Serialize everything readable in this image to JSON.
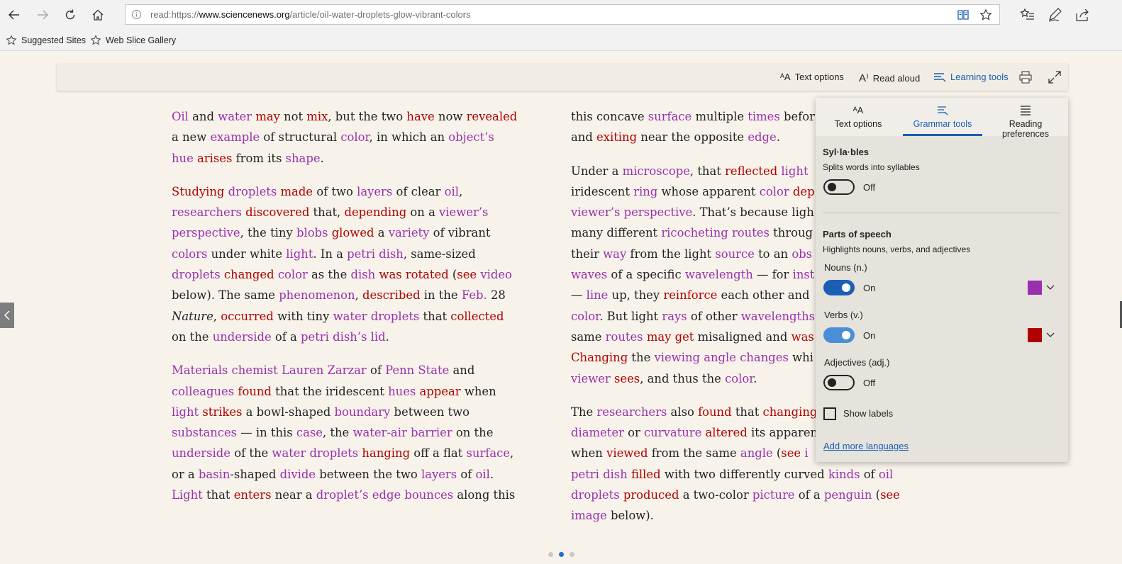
{
  "browser": {
    "url_prefix": "read:https://",
    "url_host": "www.sciencenews.org",
    "url_path": "/article/oil-water-droplets-glow-vibrant-colors",
    "favorites": [
      {
        "label": "Suggested Sites",
        "icon": "star-outline-icon"
      },
      {
        "label": "Web Slice Gallery",
        "icon": "star-outline-icon"
      }
    ]
  },
  "reading_toolbar": {
    "text_options": "Text options",
    "read_aloud": "Read aloud",
    "learning_tools": "Learning tools"
  },
  "article": {
    "col1": [
      [
        [
          "n",
          "Oil"
        ],
        [
          "t",
          " and "
        ],
        [
          "n",
          "water"
        ],
        [
          "t",
          " "
        ],
        [
          "v",
          "may"
        ],
        [
          "t",
          " not "
        ],
        [
          "v",
          "mix"
        ],
        [
          "t",
          ", but the two "
        ],
        [
          "v",
          "have"
        ],
        [
          "t",
          " now "
        ],
        [
          "v",
          "revealed"
        ],
        [
          "br"
        ],
        [
          "t",
          "a new "
        ],
        [
          "n",
          "example"
        ],
        [
          "t",
          " of structural "
        ],
        [
          "n",
          "color"
        ],
        [
          "t",
          ", in which an "
        ],
        [
          "n",
          "object’s"
        ],
        [
          "br"
        ],
        [
          "n",
          "hue"
        ],
        [
          "t",
          " "
        ],
        [
          "v",
          "arises"
        ],
        [
          "t",
          " from its "
        ],
        [
          "n",
          "shape"
        ],
        [
          "t",
          "."
        ]
      ],
      [
        [
          "v",
          "Studying"
        ],
        [
          "t",
          " "
        ],
        [
          "n",
          "droplets"
        ],
        [
          "t",
          " "
        ],
        [
          "v",
          "made"
        ],
        [
          "t",
          " of two "
        ],
        [
          "n",
          "layers"
        ],
        [
          "t",
          " of clear "
        ],
        [
          "n",
          "oil"
        ],
        [
          "t",
          ","
        ],
        [
          "br"
        ],
        [
          "n",
          "researchers"
        ],
        [
          "t",
          " "
        ],
        [
          "v",
          "discovered"
        ],
        [
          "t",
          " that, "
        ],
        [
          "v",
          "depending"
        ],
        [
          "t",
          " on a "
        ],
        [
          "n",
          "viewer’s"
        ],
        [
          "br"
        ],
        [
          "n",
          "perspective"
        ],
        [
          "t",
          ", the tiny "
        ],
        [
          "n",
          "blobs"
        ],
        [
          "t",
          " "
        ],
        [
          "v",
          "glowed"
        ],
        [
          "t",
          " a "
        ],
        [
          "n",
          "variety"
        ],
        [
          "t",
          " of vibrant"
        ],
        [
          "br"
        ],
        [
          "n",
          "colors"
        ],
        [
          "t",
          " under white "
        ],
        [
          "n",
          "light"
        ],
        [
          "t",
          ". In a "
        ],
        [
          "n",
          "petri dish"
        ],
        [
          "t",
          ", same-sized"
        ],
        [
          "br"
        ],
        [
          "n",
          "droplets"
        ],
        [
          "t",
          " "
        ],
        [
          "v",
          "changed"
        ],
        [
          "t",
          " "
        ],
        [
          "n",
          "color"
        ],
        [
          "t",
          " as the "
        ],
        [
          "n",
          "dish"
        ],
        [
          "t",
          " "
        ],
        [
          "v",
          "was rotated"
        ],
        [
          "t",
          " ("
        ],
        [
          "v",
          "see"
        ],
        [
          "t",
          " "
        ],
        [
          "n",
          "video"
        ],
        [
          "br"
        ],
        [
          "t",
          "below). The same "
        ],
        [
          "n",
          "phenomenon"
        ],
        [
          "t",
          ", "
        ],
        [
          "v",
          "described"
        ],
        [
          "t",
          " in the "
        ],
        [
          "n",
          "Feb."
        ],
        [
          "t",
          " 28"
        ],
        [
          "br"
        ],
        [
          "i",
          "Nature"
        ],
        [
          "t",
          ", "
        ],
        [
          "v",
          "occurred"
        ],
        [
          "t",
          " with tiny "
        ],
        [
          "n",
          "water droplets"
        ],
        [
          "t",
          " that "
        ],
        [
          "v",
          "collected"
        ],
        [
          "br"
        ],
        [
          "t",
          "on the "
        ],
        [
          "n",
          "underside"
        ],
        [
          "t",
          " of a "
        ],
        [
          "n",
          "petri dish’s lid"
        ],
        [
          "t",
          "."
        ]
      ],
      [
        [
          "n",
          "Materials chemist Lauren Zarzar"
        ],
        [
          "t",
          " of "
        ],
        [
          "n",
          "Penn State"
        ],
        [
          "t",
          " and"
        ],
        [
          "br"
        ],
        [
          "n",
          "colleagues"
        ],
        [
          "t",
          " "
        ],
        [
          "v",
          "found"
        ],
        [
          "t",
          " that the iridescent "
        ],
        [
          "n",
          "hues"
        ],
        [
          "t",
          " "
        ],
        [
          "v",
          "appear"
        ],
        [
          "t",
          " when"
        ],
        [
          "br"
        ],
        [
          "n",
          "light"
        ],
        [
          "t",
          " "
        ],
        [
          "v",
          "strikes"
        ],
        [
          "t",
          " a bowl-shaped "
        ],
        [
          "n",
          "boundary"
        ],
        [
          "t",
          " between two"
        ],
        [
          "br"
        ],
        [
          "n",
          "substances"
        ],
        [
          "t",
          " — in this "
        ],
        [
          "n",
          "case"
        ],
        [
          "t",
          ", the "
        ],
        [
          "n",
          "water-air barrier"
        ],
        [
          "t",
          " on the"
        ],
        [
          "br"
        ],
        [
          "n",
          "underside"
        ],
        [
          "t",
          " of the "
        ],
        [
          "n",
          "water droplets"
        ],
        [
          "t",
          " "
        ],
        [
          "v",
          "hanging"
        ],
        [
          "t",
          " off a flat "
        ],
        [
          "n",
          "surface"
        ],
        [
          "t",
          ","
        ],
        [
          "br"
        ],
        [
          "t",
          "or a "
        ],
        [
          "n",
          "basin"
        ],
        [
          "t",
          "-shaped "
        ],
        [
          "n",
          "divide"
        ],
        [
          "t",
          " between the two "
        ],
        [
          "n",
          "layers"
        ],
        [
          "t",
          " of "
        ],
        [
          "n",
          "oil"
        ],
        [
          "t",
          "."
        ],
        [
          "br"
        ],
        [
          "n",
          "Light"
        ],
        [
          "t",
          " that "
        ],
        [
          "v",
          "enters"
        ],
        [
          "t",
          " near a "
        ],
        [
          "n",
          "droplet’s edge bounces"
        ],
        [
          "t",
          " along this"
        ]
      ]
    ],
    "col2": [
      [
        [
          "t",
          "this concave "
        ],
        [
          "n",
          "surface"
        ],
        [
          "t",
          " multiple "
        ],
        [
          "n",
          "times"
        ],
        [
          "t",
          " befor"
        ],
        [
          "br"
        ],
        [
          "t",
          "and "
        ],
        [
          "v",
          "exiting"
        ],
        [
          "t",
          " near the opposite "
        ],
        [
          "n",
          "edge"
        ],
        [
          "t",
          "."
        ]
      ],
      [
        [
          "t",
          "Under a "
        ],
        [
          "n",
          "microscope"
        ],
        [
          "t",
          ", that "
        ],
        [
          "v",
          "reflected"
        ],
        [
          "t",
          " "
        ],
        [
          "n",
          "light"
        ],
        [
          "br"
        ],
        [
          "t",
          "iridescent "
        ],
        [
          "n",
          "ring"
        ],
        [
          "t",
          " whose apparent "
        ],
        [
          "n",
          "color"
        ],
        [
          "t",
          " "
        ],
        [
          "v",
          "dep"
        ],
        [
          "br"
        ],
        [
          "n",
          "viewer’s perspective"
        ],
        [
          "t",
          ". That’s because ligh"
        ],
        [
          "br"
        ],
        [
          "t",
          "many different "
        ],
        [
          "n",
          "ricocheting routes"
        ],
        [
          "t",
          " throug"
        ],
        [
          "br"
        ],
        [
          "t",
          "their "
        ],
        [
          "n",
          "way"
        ],
        [
          "t",
          " from the light "
        ],
        [
          "n",
          "source"
        ],
        [
          "t",
          " to an "
        ],
        [
          "n",
          "obs"
        ],
        [
          "br"
        ],
        [
          "n",
          "waves"
        ],
        [
          "t",
          " of a specific "
        ],
        [
          "n",
          "wavelength"
        ],
        [
          "t",
          " — for "
        ],
        [
          "n",
          "inst"
        ],
        [
          "br"
        ],
        [
          "t",
          "— "
        ],
        [
          "n",
          "line"
        ],
        [
          "t",
          " up, they "
        ],
        [
          "v",
          "reinforce"
        ],
        [
          "t",
          " each other and"
        ],
        [
          "br"
        ],
        [
          "n",
          "color"
        ],
        [
          "t",
          ". But light "
        ],
        [
          "n",
          "rays"
        ],
        [
          "t",
          " of other "
        ],
        [
          "n",
          "wavelengths"
        ],
        [
          "br"
        ],
        [
          "t",
          "same "
        ],
        [
          "n",
          "routes"
        ],
        [
          "t",
          " "
        ],
        [
          "v",
          "may get"
        ],
        [
          "t",
          " misaligned and "
        ],
        [
          "v",
          "was"
        ],
        [
          "br"
        ],
        [
          "v",
          "Changing"
        ],
        [
          "t",
          " the "
        ],
        [
          "n",
          "viewing angle changes"
        ],
        [
          "t",
          " whi"
        ],
        [
          "br"
        ],
        [
          "n",
          "viewer"
        ],
        [
          "t",
          " "
        ],
        [
          "v",
          "sees"
        ],
        [
          "t",
          ", and thus the "
        ],
        [
          "n",
          "color"
        ],
        [
          "t",
          "."
        ]
      ],
      [
        [
          "t",
          "The "
        ],
        [
          "n",
          "researchers"
        ],
        [
          "t",
          " also "
        ],
        [
          "v",
          "found"
        ],
        [
          "t",
          " that "
        ],
        [
          "v",
          "changing"
        ],
        [
          "br"
        ],
        [
          "n",
          "diameter"
        ],
        [
          "t",
          " or "
        ],
        [
          "n",
          "curvature"
        ],
        [
          "t",
          " "
        ],
        [
          "v",
          "altered"
        ],
        [
          "t",
          " its apparen"
        ],
        [
          "br"
        ],
        [
          "t",
          "when "
        ],
        [
          "v",
          "viewed"
        ],
        [
          "t",
          " from the same "
        ],
        [
          "n",
          "angle"
        ],
        [
          "t",
          " ("
        ],
        [
          "v",
          "see"
        ],
        [
          "t",
          " "
        ],
        [
          "n",
          "i"
        ],
        [
          "br"
        ],
        [
          "n",
          "petri dish"
        ],
        [
          "t",
          " "
        ],
        [
          "v",
          "filled"
        ],
        [
          "t",
          " with two differently curved "
        ],
        [
          "n",
          "kinds"
        ],
        [
          "t",
          " of "
        ],
        [
          "n",
          "oil"
        ],
        [
          "br"
        ],
        [
          "n",
          "droplets"
        ],
        [
          "t",
          " "
        ],
        [
          "v",
          "produced"
        ],
        [
          "t",
          " a two-color "
        ],
        [
          "n",
          "picture"
        ],
        [
          "t",
          " of a "
        ],
        [
          "n",
          "penguin"
        ],
        [
          "t",
          " ("
        ],
        [
          "v",
          "see"
        ],
        [
          "br"
        ],
        [
          "n",
          "image"
        ],
        [
          "t",
          " below)."
        ]
      ]
    ]
  },
  "panel": {
    "tabs": [
      {
        "label": "Text options",
        "icon": "text-size-icon",
        "active": false
      },
      {
        "label": "Grammar tools",
        "icon": "grammar-icon",
        "active": true
      },
      {
        "label": "Reading preferences",
        "icon": "lines-icon",
        "active": false
      }
    ],
    "syllables": {
      "title": "Syl·la·bles",
      "desc": "Splits words into syllables",
      "state": "Off"
    },
    "parts_of_speech": {
      "title": "Parts of speech",
      "desc": "Highlights nouns, verbs, and adjectives"
    },
    "nouns": {
      "label": "Nouns (n.)",
      "state": "On",
      "color": "#9b2fae"
    },
    "verbs": {
      "label": "Verbs (v.)",
      "state": "On",
      "color": "#b00000"
    },
    "adjectives": {
      "label": "Adjectives (adj.)",
      "state": "Off"
    },
    "show_labels": "Show labels",
    "add_languages": "Add more languages"
  },
  "pagination": {
    "pages": 3,
    "current": 2
  },
  "colors": {
    "noun": "#9b2fae",
    "verb": "#b00000",
    "accent": "#1a5fb4",
    "page_bg": "#f7f3ea"
  }
}
